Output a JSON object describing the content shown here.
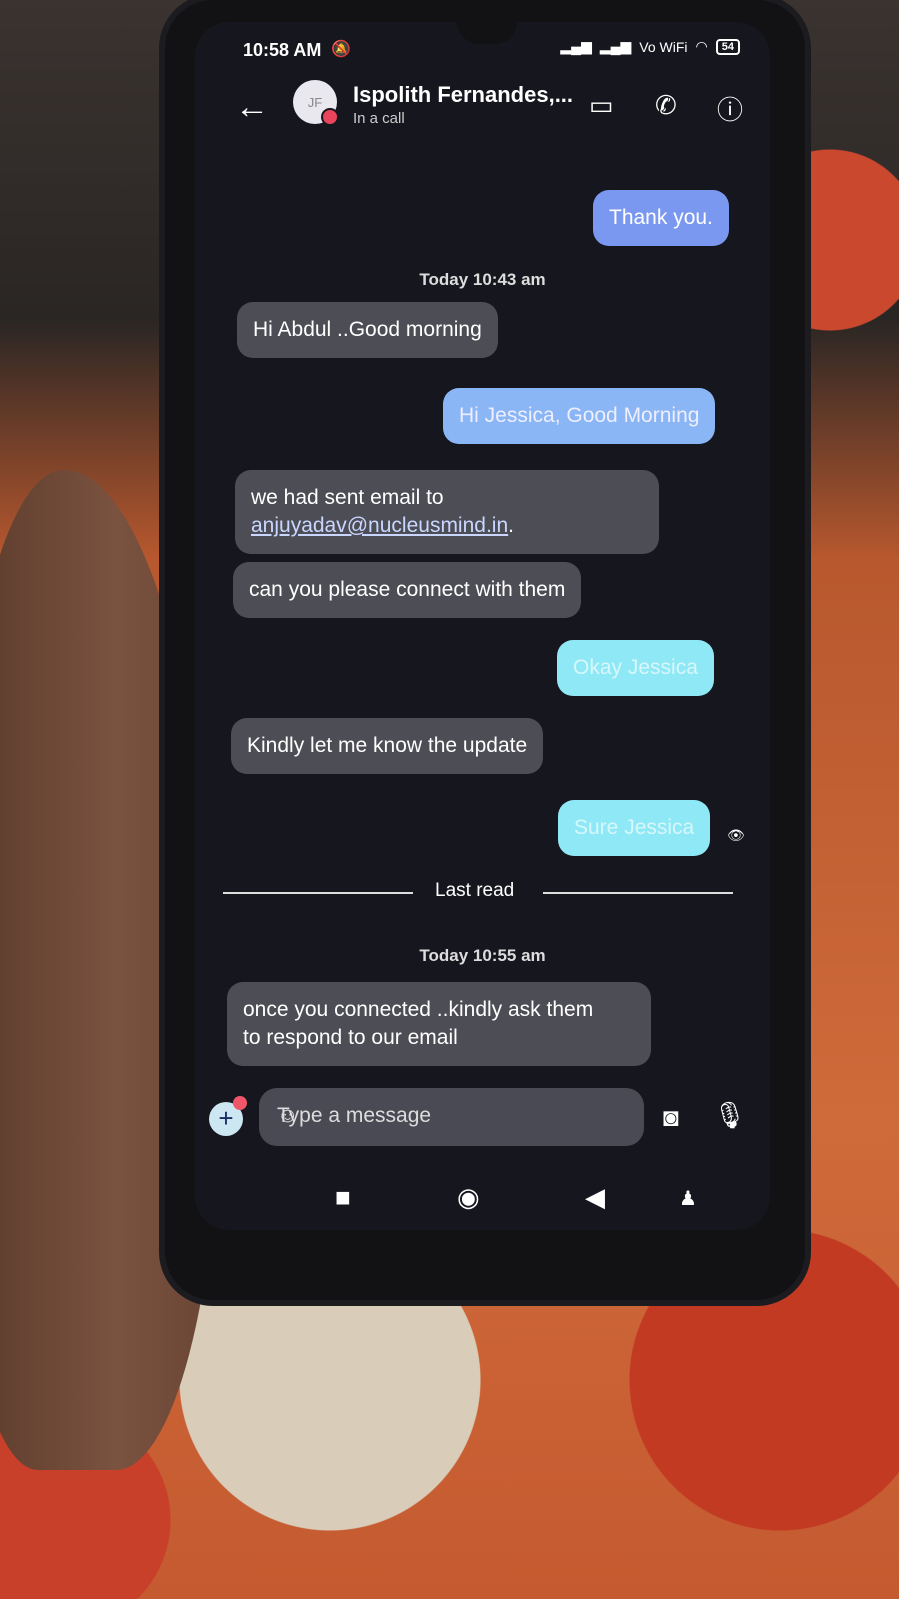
{
  "status_bar": {
    "time": "10:58 AM",
    "network": "Vo WiFi",
    "battery": "54"
  },
  "header": {
    "avatar_initials": "JF",
    "contact_name": "Ispolith Fernandes,...",
    "status": "In a call"
  },
  "messages": [
    {
      "direction": "out",
      "text": "Thank you."
    },
    {
      "type": "timestamp",
      "text": "Today 10:43 am"
    },
    {
      "direction": "in",
      "text": "Hi Abdul ..Good morning"
    },
    {
      "direction": "out",
      "text": "Hi Jessica, Good Morning"
    },
    {
      "direction": "in",
      "text_line1": "we had sent email to",
      "link": "anjuyadav@nucleusmind.in",
      "suffix": "."
    },
    {
      "direction": "in",
      "text": "can you please connect with them"
    },
    {
      "direction": "out",
      "text": "Okay Jessica"
    },
    {
      "direction": "in",
      "text": "Kindly let me know the update"
    },
    {
      "direction": "out",
      "text": "Sure Jessica"
    },
    {
      "type": "divider",
      "text": "Last read"
    },
    {
      "type": "timestamp",
      "text": "Today 10:55 am"
    },
    {
      "direction": "in",
      "text_line1": "once you connected ..kindly ask them",
      "text_line2": "to respond to our email"
    }
  ],
  "composer": {
    "placeholder": "Type a message"
  },
  "colors": {
    "incoming_bubble": "#4d4d55",
    "outgoing_bubble": "#7a98f0",
    "background": "#16161f"
  }
}
